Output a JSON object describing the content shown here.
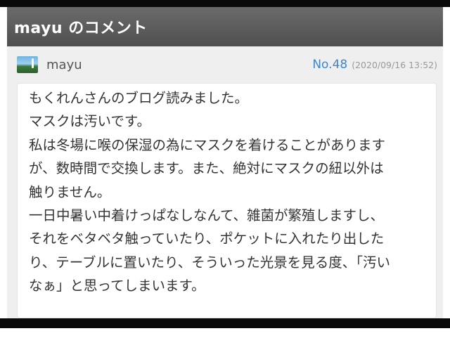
{
  "header": {
    "title": "mayu のコメント"
  },
  "comment": {
    "author": "mayu",
    "number": "No.48",
    "datetime": "(2020/09/16 13:52)",
    "lines": [
      "もくれんさんのブログ読みました。",
      "マスクは汚いです。",
      "私は冬場に喉の保湿の為にマスクを着けることがあります",
      "が、数時間で交換します。また、絶対にマスクの紐以外は",
      "触りません。",
      "一日中暑い中着けっぱなしなんて、雑菌が繁殖しますし、",
      "それをベタベタ触っていたり、ポケットに入れたり出した",
      "り、テーブルに置いたり、そういった光景を見る度、「汚い",
      "なぁ」と思ってしまいます。"
    ]
  },
  "icons": {
    "avatar": "user-avatar-landscape"
  },
  "colors": {
    "header_bg": "#585858",
    "link_blue": "#3f86c8",
    "panel_bg": "#efefef"
  }
}
